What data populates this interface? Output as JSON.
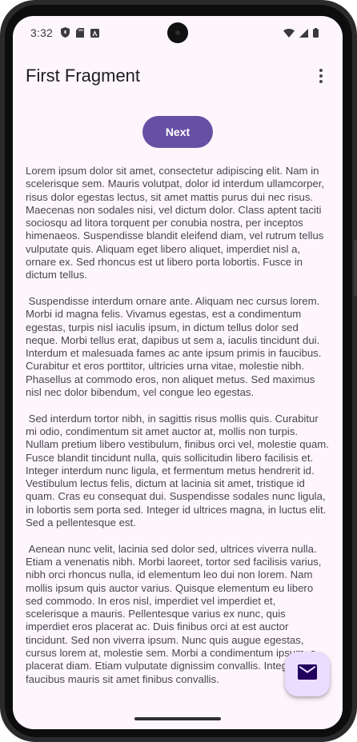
{
  "status_bar": {
    "time": "3:32"
  },
  "app_bar": {
    "title": "First Fragment",
    "overflow_icon": "more-vert-icon"
  },
  "main": {
    "next_button_label": "Next",
    "paragraphs": [
      "Lorem ipsum dolor sit amet, consectetur adipiscing elit. Nam in scelerisque sem. Mauris volutpat, dolor id interdum ullamcorper, risus dolor egestas lectus, sit amet mattis purus dui nec risus. Maecenas non sodales nisi, vel dictum dolor. Class aptent taciti sociosqu ad litora torquent per conubia nostra, per inceptos himenaeos. Suspendisse blandit eleifend diam, vel rutrum tellus vulputate quis. Aliquam eget libero aliquet, imperdiet nisl a, ornare ex. Sed rhoncus est ut libero porta lobortis. Fusce in dictum tellus.",
      " Suspendisse interdum ornare ante. Aliquam nec cursus lorem. Morbi id magna felis. Vivamus egestas, est a condimentum egestas, turpis nisl iaculis ipsum, in dictum tellus dolor sed neque. Morbi tellus erat, dapibus ut sem a, iaculis tincidunt dui. Interdum et malesuada fames ac ante ipsum primis in faucibus. Curabitur et eros porttitor, ultricies urna vitae, molestie nibh. Phasellus at commodo eros, non aliquet metus. Sed maximus nisl nec dolor bibendum, vel congue leo egestas.",
      " Sed interdum tortor nibh, in sagittis risus mollis quis. Curabitur mi odio, condimentum sit amet auctor at, mollis non turpis. Nullam pretium libero vestibulum, finibus orci vel, molestie quam. Fusce blandit tincidunt nulla, quis sollicitudin libero facilisis et. Integer interdum nunc ligula, et fermentum metus hendrerit id. Vestibulum lectus felis, dictum at lacinia sit amet, tristique id quam. Cras eu consequat dui. Suspendisse sodales nunc ligula, in lobortis sem porta sed. Integer id ultrices magna, in luctus elit. Sed a pellentesque est.",
      " Aenean nunc velit, lacinia sed dolor sed, ultrices viverra nulla. Etiam a venenatis nibh. Morbi laoreet, tortor sed facilisis varius, nibh orci rhoncus nulla, id elementum leo dui non lorem. Nam mollis ipsum quis auctor varius. Quisque elementum eu libero sed commodo. In eros nisl, imperdiet vel imperdiet et, scelerisque a mauris. Pellentesque varius ex nunc, quis imperdiet eros placerat ac. Duis finibus orci at est auctor tincidunt. Sed non viverra ipsum. Nunc quis augue egestas, cursus lorem at, molestie sem. Morbi a condimentum ipsum, a placerat diam. Etiam vulputate dignissim convallis. Integer faucibus mauris sit amet finibus convallis."
    ]
  },
  "fab": {
    "icon": "email-icon"
  },
  "colors": {
    "primary": "#6750a4",
    "fab_container": "#eaddff",
    "fab_icon": "#21005d",
    "background": "#fdf7fd",
    "body_text": "#49454f",
    "title_text": "#1d1b20"
  }
}
